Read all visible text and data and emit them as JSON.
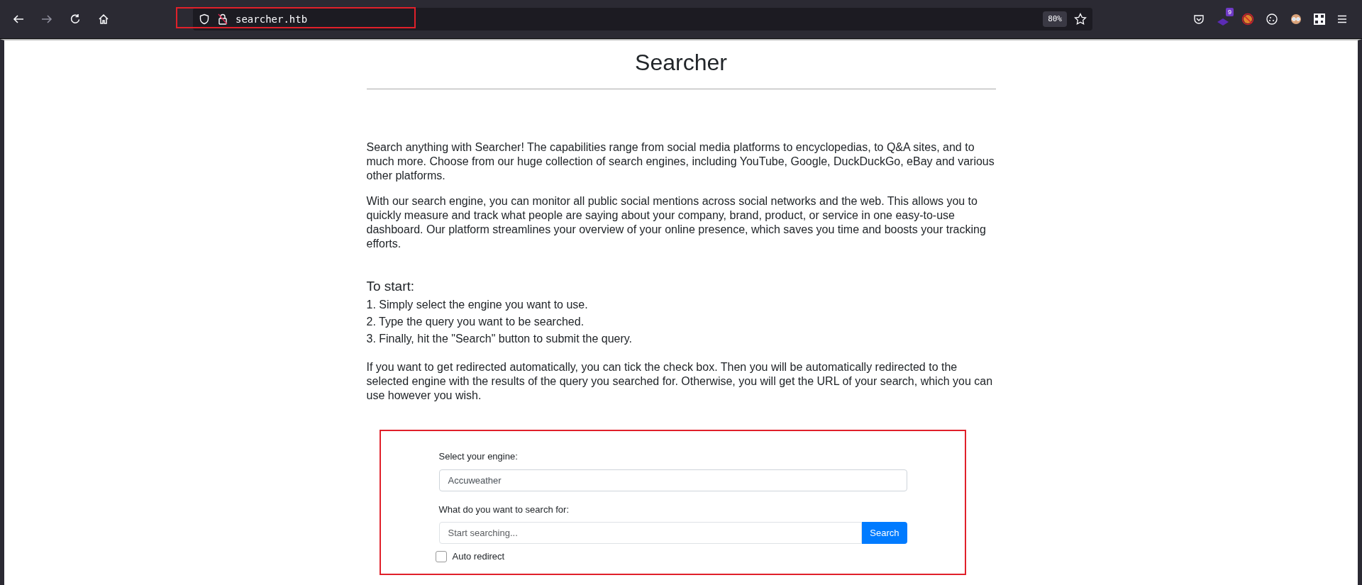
{
  "browser": {
    "url": "searcher.htb",
    "zoom": "80%",
    "extension_badge": "9",
    "forward_disabled": true
  },
  "page": {
    "title": "Searcher",
    "paragraphs": [
      "Search anything with Searcher! The capabilities range from social media platforms to encyclopedias, to Q&A sites, and to much more. Choose from our huge collection of search engines, including YouTube, Google, DuckDuckGo, eBay and various other platforms.",
      "With our search engine, you can monitor all public social mentions across social networks and the web. This allows you to quickly measure and track what people are saying about your company, brand, product, or service in one easy-to-use dashboard. Our platform streamlines your overview of your online presence, which saves you time and boosts your tracking efforts."
    ],
    "steps_heading": "To start:",
    "steps": [
      "1. Simply select the engine you want to use.",
      "2. Type the query you want to be searched.",
      "3. Finally, hit the \"Search\" button to submit the query."
    ],
    "note": "If you want to get redirected automatically, you can tick the check box. Then you will be automatically redirected to the selected engine with the results of the query you searched for. Otherwise, you will get the URL of your search, which you can use however you wish.",
    "form": {
      "engine_label": "Select your engine:",
      "engine_value": "Accuweather",
      "query_label": "What do you want to search for:",
      "query_placeholder": "Start searching...",
      "search_button": "Search",
      "auto_redirect": {
        "label": "Auto redirect",
        "checked": false
      }
    }
  }
}
